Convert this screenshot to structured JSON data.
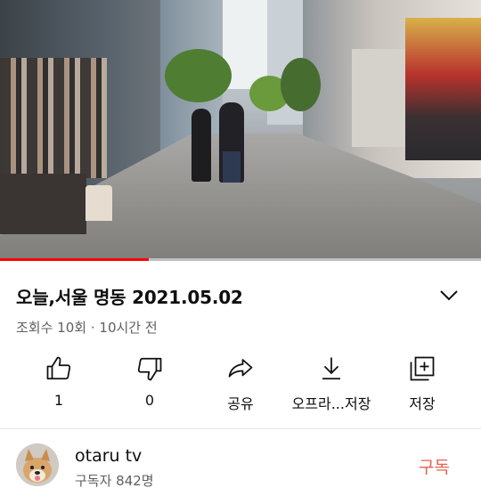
{
  "video": {
    "progress_fraction": 0.31
  },
  "info": {
    "title": "오늘,서울 명동 2021.05.02",
    "views": "조회수 10회",
    "separator": "·",
    "age": "10시간 전"
  },
  "actions": {
    "like": {
      "label": "1",
      "icon": "thumbs-up-icon"
    },
    "dislike": {
      "label": "0",
      "icon": "thumbs-down-icon"
    },
    "share": {
      "label": "공유",
      "icon": "share-arrow-icon"
    },
    "download": {
      "label": "오프라...저장",
      "icon": "download-icon"
    },
    "save": {
      "label": "저장",
      "icon": "add-to-playlist-icon"
    }
  },
  "channel": {
    "name": "otaru tv",
    "subscribers": "구독자 842명",
    "subscribe_label": "구독"
  },
  "colors": {
    "progress": "#ff0000",
    "subscribe": "#e4614f",
    "secondary_text": "#606060"
  }
}
